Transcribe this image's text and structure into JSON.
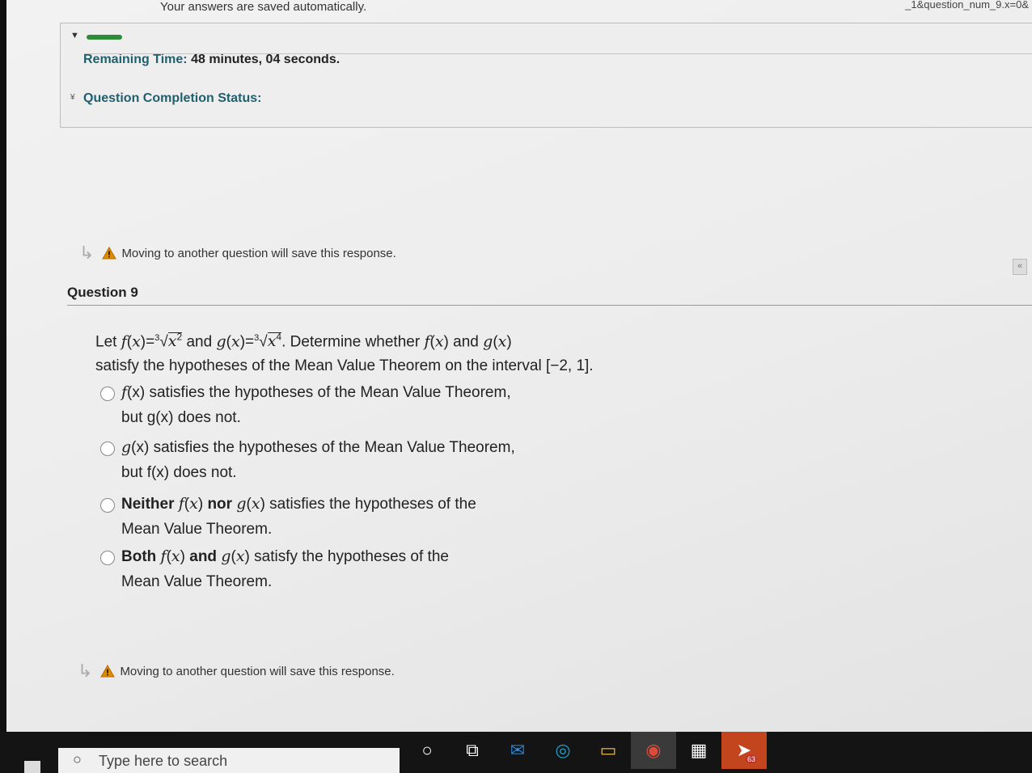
{
  "header": {
    "autosave_notice": "Your answers are saved automatically.",
    "url_fragment": "_1&question_num_9.x=0&"
  },
  "status_panel": {
    "remaining_time_label": "Remaining Time:",
    "remaining_time_value": "48 minutes, 04 seconds.",
    "question_completion_label": "Question Completion Status:"
  },
  "warnings": {
    "top": "Moving to another question will save this response.",
    "bottom": "Moving to another question will save this response."
  },
  "question": {
    "title": "Question 9",
    "stem_line2": "satisfy the hypotheses of the Mean Value Theorem on the interval [−2, 1].",
    "options": [
      {
        "line1_rest": " satisfies the hypotheses of the Mean Value Theorem,",
        "line2": "but g(x) does not."
      },
      {
        "line1_rest": " satisfies the hypotheses of the Mean Value Theorem,",
        "line2": "but f(x) does not."
      },
      {
        "line1_rest": "satisfies the hypotheses of the",
        "line2": "Mean Value Theorem."
      },
      {
        "line1_rest": "satisfy the hypotheses of the",
        "line2": "Mean Value Theorem."
      }
    ]
  },
  "taskbar": {
    "search_placeholder": "Type here to search",
    "telegram_badge": "63",
    "icons": [
      "cortana-icon",
      "task-view-icon",
      "mail-icon",
      "edge-icon",
      "file-explorer-icon",
      "chrome-icon",
      "store-icon",
      "telegram-icon"
    ]
  },
  "colors": {
    "teal_label": "#1f5f6e",
    "progress_green": "#2e8b3a",
    "warning_orange": "#e08a00"
  }
}
